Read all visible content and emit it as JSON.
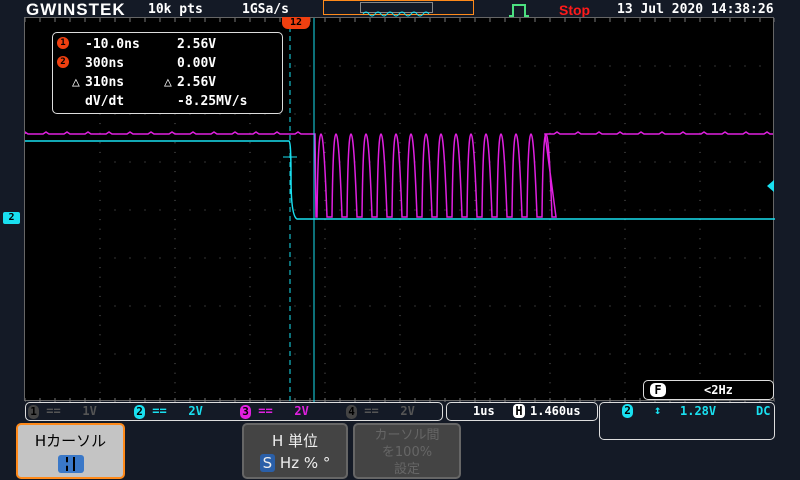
{
  "header": {
    "brand": "GWINSTEK",
    "record_length": "10k pts",
    "sample_rate": "1GSa/s",
    "run_state": "Stop",
    "datetime": "13 Jul 2020 14:38:26"
  },
  "colors": {
    "ch1": "#f04010",
    "ch2": "#19e0f0",
    "ch3": "#e020e0",
    "ch4": "#555555",
    "stop": "#ff1a1a",
    "accent": "#ff8a1a"
  },
  "cursor_readout": {
    "c1_label": "1",
    "c1_time": "-10.0ns",
    "c1_volt": "2.56V",
    "c2_label": "2",
    "c2_time": "300ns",
    "c2_volt": "0.00V",
    "delta_symbol": "△",
    "delta_time": "310ns",
    "delta_volt": "2.56V",
    "dvdt_label": "dV/dt",
    "dvdt_value": "-8.25MV/s"
  },
  "cursor_marker": "12",
  "channels": [
    {
      "num": "1",
      "coupling": "==",
      "scale": "1V"
    },
    {
      "num": "2",
      "coupling": "==",
      "scale": "2V"
    },
    {
      "num": "3",
      "coupling": "==",
      "scale": "2V"
    },
    {
      "num": "4",
      "coupling": "==",
      "scale": "2V"
    }
  ],
  "timebase": {
    "scale": "1us",
    "h_label": "H",
    "position": "1.460us"
  },
  "trigger": {
    "source": "2",
    "slope_icon": "updown-arrow-icon",
    "level": "1.28V",
    "coupling": "DC"
  },
  "frequency": {
    "label": "F",
    "value": "<2Hz"
  },
  "softkeys": {
    "h_cursor": "Hカーソル",
    "h_unit_title": "H 単位",
    "h_unit_s": "S",
    "h_unit_rest": "Hz % °",
    "set_100_line1": "カーソル間",
    "set_100_line2": "を100%",
    "set_100_line3": "設定"
  },
  "ch2_marker": "2"
}
